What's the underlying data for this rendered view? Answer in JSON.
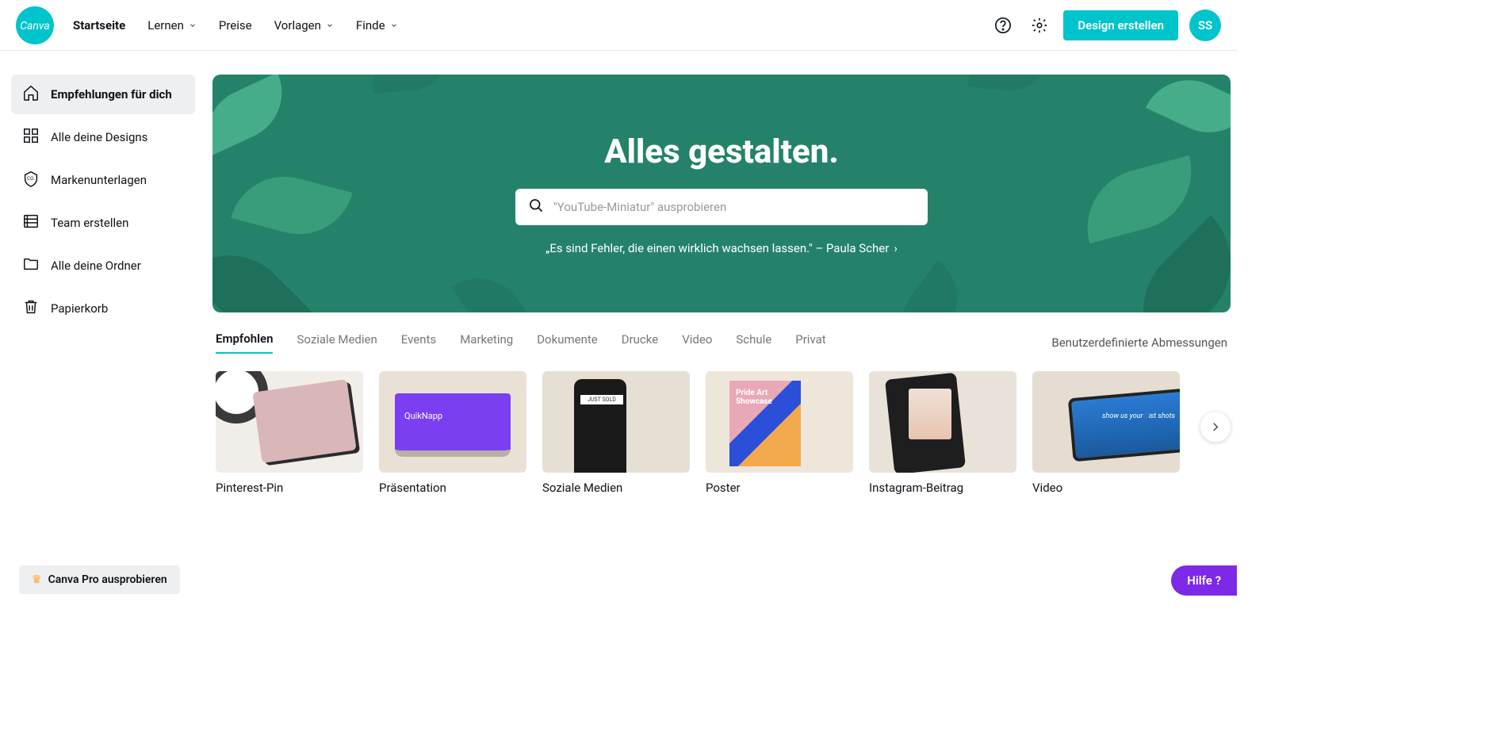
{
  "brand": {
    "name": "Canva"
  },
  "header": {
    "nav": [
      {
        "label": "Startseite",
        "active": true,
        "has_chevron": false
      },
      {
        "label": "Lernen",
        "active": false,
        "has_chevron": true
      },
      {
        "label": "Preise",
        "active": false,
        "has_chevron": false
      },
      {
        "label": "Vorlagen",
        "active": false,
        "has_chevron": true
      },
      {
        "label": "Finde",
        "active": false,
        "has_chevron": true
      }
    ],
    "create_button": "Design erstellen",
    "avatar_initials": "SS"
  },
  "sidebar": {
    "items": [
      {
        "label": "Empfehlungen für dich",
        "icon": "home",
        "active": true
      },
      {
        "label": "Alle deine Designs",
        "icon": "grid",
        "active": false
      },
      {
        "label": "Markenunterlagen",
        "icon": "brand",
        "active": false
      },
      {
        "label": "Team erstellen",
        "icon": "team",
        "active": false
      },
      {
        "label": "Alle deine Ordner",
        "icon": "folder",
        "active": false
      },
      {
        "label": "Papierkorb",
        "icon": "trash",
        "active": false
      }
    ],
    "pro_button": "Canva Pro ausprobieren"
  },
  "hero": {
    "title": "Alles gestalten.",
    "search_placeholder": "\"YouTube-Miniatur\" ausprobieren",
    "quote": "„Es sind Fehler, die einen wirklich wachsen lassen.\" – Paula Scher"
  },
  "tabs": {
    "items": [
      {
        "label": "Empfohlen",
        "active": true
      },
      {
        "label": "Soziale Medien",
        "active": false
      },
      {
        "label": "Events",
        "active": false
      },
      {
        "label": "Marketing",
        "active": false
      },
      {
        "label": "Dokumente",
        "active": false
      },
      {
        "label": "Drucke",
        "active": false
      },
      {
        "label": "Video",
        "active": false
      },
      {
        "label": "Schule",
        "active": false
      },
      {
        "label": "Privat",
        "active": false
      }
    ],
    "custom_dimensions": "Benutzerdefinierte Abmessungen"
  },
  "cards": [
    {
      "label": "Pinterest-Pin",
      "thumb": "pin"
    },
    {
      "label": "Präsentation",
      "thumb": "pres"
    },
    {
      "label": "Soziale Medien",
      "thumb": "social"
    },
    {
      "label": "Poster",
      "thumb": "poster"
    },
    {
      "label": "Instagram-Beitrag",
      "thumb": "insta"
    },
    {
      "label": "Video",
      "thumb": "video"
    }
  ],
  "help_button": "Hilfe ?",
  "colors": {
    "accent": "#00c4cc",
    "hero": "#24826b",
    "help": "#7d2ae8"
  }
}
